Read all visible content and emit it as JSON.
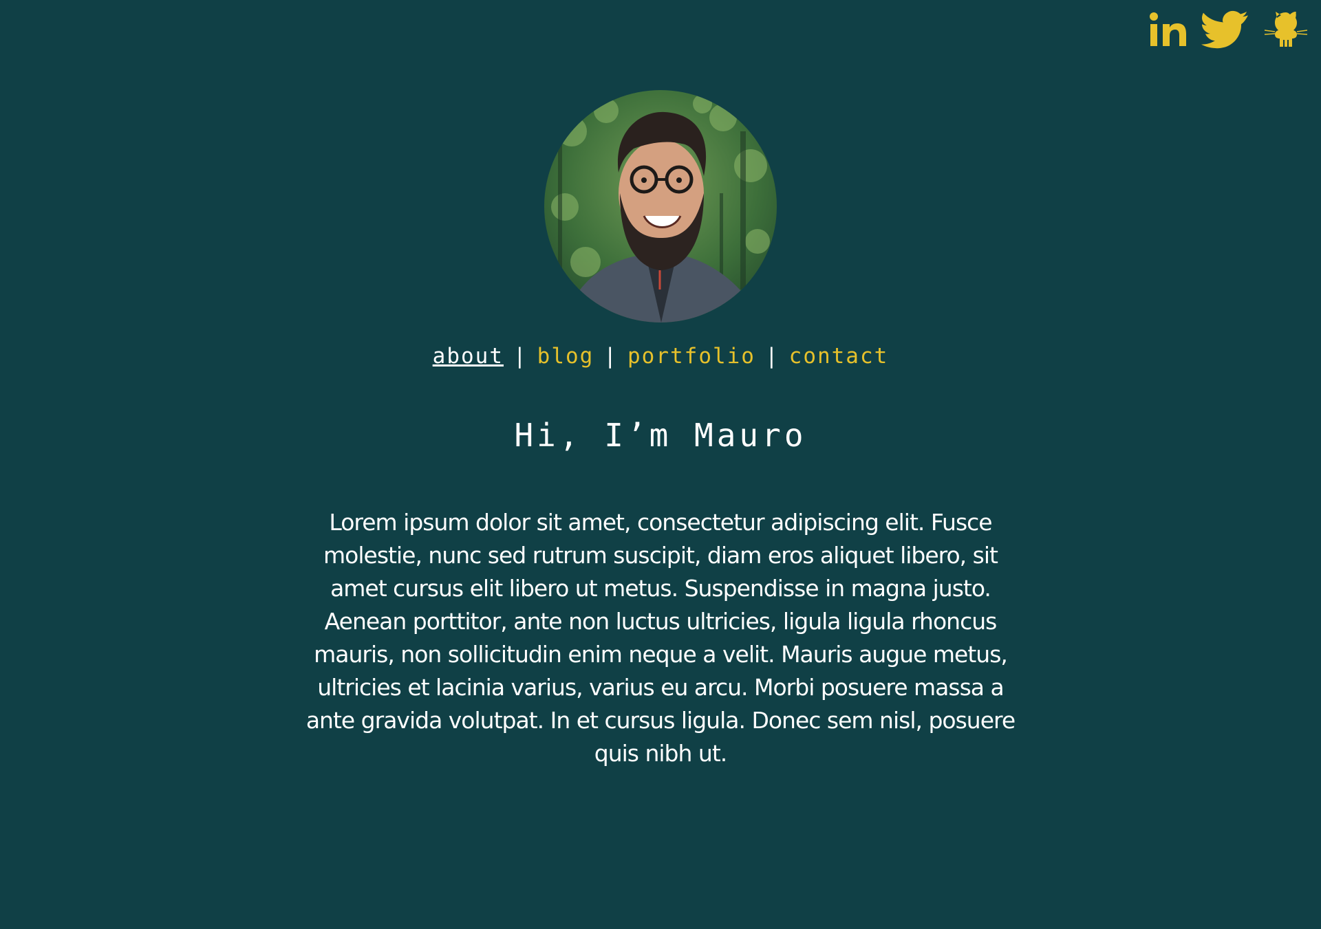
{
  "social": {
    "links": [
      {
        "name": "linkedin",
        "icon": "linkedin-icon"
      },
      {
        "name": "twitter",
        "icon": "twitter-icon"
      },
      {
        "name": "github",
        "icon": "github-octocat-icon"
      }
    ]
  },
  "avatar": {
    "description": "avatar"
  },
  "nav": {
    "items": [
      {
        "label": "about",
        "active": true
      },
      {
        "label": "blog",
        "active": false
      },
      {
        "label": "portfolio",
        "active": false
      },
      {
        "label": "contact",
        "active": false
      }
    ],
    "separator": "|"
  },
  "heading": "Hi, I’m Mauro",
  "bio": "Lorem ipsum dolor sit amet, consectetur adipiscing elit. Fusce molestie, nunc sed rutrum suscipit, diam eros aliquet libero, sit amet cursus elit libero ut metus. Suspendisse in magna justo. Aenean porttitor, ante non luctus ultricies, ligula ligula rhoncus mauris, non sollicitudin enim neque a velit. Mauris augue metus, ultricies et lacinia varius, varius eu arcu. Morbi posuere massa a ante gravida volutpat. In et cursus ligula. Donec sem nisl, posuere quis nibh ut.",
  "colors": {
    "background": "#104046",
    "accent": "#e7c12b",
    "text": "#ffffff"
  }
}
